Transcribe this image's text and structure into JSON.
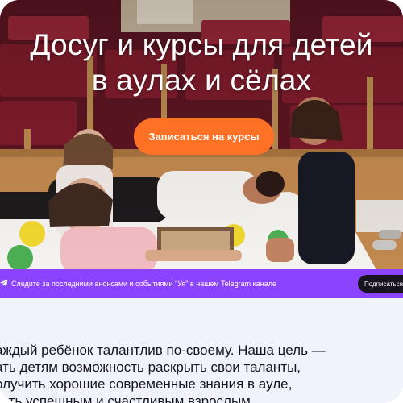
{
  "hero": {
    "title_line1": "Досуг и курсы для детей",
    "title_line2": "в аулах и сёлах",
    "cta_label": "Записаться на курсы"
  },
  "banner": {
    "text": "Следите за последними анонсами и событиями \"Уя\" в нашем Telegram канале",
    "button_label": "Подписаться",
    "icon": "telegram-icon"
  },
  "intro": {
    "line1": "аждый ребёнок талантлив по-своему. Наша цель —",
    "line2": "ать детям возможность раскрыть свои таланты,",
    "line3": "олучить хорошие современные знания в ауле,",
    "line4": "тать успешным и счастливым взрослым."
  },
  "colors": {
    "accent_orange": "#ff7225",
    "banner_purple": "#8b43ff",
    "button_dark": "#17131f",
    "intro_background": "#f1f3fb"
  }
}
